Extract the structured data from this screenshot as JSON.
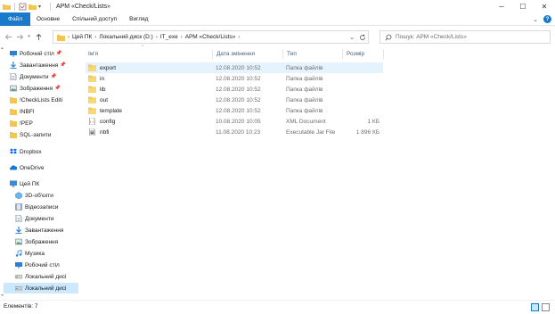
{
  "window": {
    "title": "АРМ «Check/Lists»",
    "controls": {
      "minimize": "─",
      "maximize": "☐",
      "close": "✕"
    }
  },
  "ribbon": {
    "tabs": [
      "Файл",
      "Основне",
      "Спільний доступ",
      "Вигляд"
    ],
    "expand_glyph": "⌄",
    "help_glyph": "?"
  },
  "address_bar": {
    "breadcrumbs": [
      "Цей ПК",
      "Локальний диск (D:)",
      "IT_exe",
      "АРМ «Check/Lists»"
    ],
    "separator": "›"
  },
  "search": {
    "placeholder": "Пошук: АРМ «Check/Lists»"
  },
  "nav_pane": {
    "items": [
      {
        "label": "Робочий стіл",
        "icon": "desktop-icon",
        "pinned": true
      },
      {
        "label": "Завантаження",
        "icon": "download-icon",
        "pinned": true
      },
      {
        "label": "Документи",
        "icon": "documents-icon",
        "pinned": true
      },
      {
        "label": "Зображення",
        "icon": "pictures-icon",
        "pinned": true
      },
      {
        "label": "!CheckLists Editi",
        "icon": "folder-icon",
        "pinned": false
      },
      {
        "label": "INBFI",
        "icon": "folder-icon",
        "pinned": false
      },
      {
        "label": "!PEP",
        "icon": "folder-icon",
        "pinned": false
      },
      {
        "label": "SQL-запити",
        "icon": "folder-icon",
        "pinned": false
      },
      {
        "label": "Dropbox",
        "icon": "dropbox-icon",
        "pinned": false
      },
      {
        "label": "OneDrive",
        "icon": "onedrive-icon",
        "pinned": false
      },
      {
        "label": "Цей ПК",
        "icon": "computer-icon",
        "pinned": false
      },
      {
        "label": "3D-об'єкти",
        "icon": "3d-objects-icon",
        "pinned": false
      },
      {
        "label": "Відеозаписи",
        "icon": "videos-icon",
        "pinned": false
      },
      {
        "label": "Документи",
        "icon": "documents-icon",
        "pinned": false
      },
      {
        "label": "Завантаження",
        "icon": "download-icon",
        "pinned": false
      },
      {
        "label": "Зображення",
        "icon": "pictures-icon",
        "pinned": false
      },
      {
        "label": "Музика",
        "icon": "music-icon",
        "pinned": false
      },
      {
        "label": "Робочий стіл",
        "icon": "desktop-icon",
        "pinned": false
      },
      {
        "label": "Локальний дисі",
        "icon": "drive-icon",
        "pinned": false
      },
      {
        "label": "Локальний дисі",
        "icon": "drive-icon",
        "pinned": false
      }
    ]
  },
  "columns": {
    "name": "Ім'я",
    "date": "Дата змінення",
    "type": "Тип",
    "size": "Розмір"
  },
  "files": [
    {
      "name": "export",
      "date": "12.08.2020 10:52",
      "type": "Папка файлів",
      "size": "",
      "icon": "folder-icon"
    },
    {
      "name": "in",
      "date": "12.08.2020 10:52",
      "type": "Папка файлів",
      "size": "",
      "icon": "folder-icon"
    },
    {
      "name": "lib",
      "date": "12.08.2020 10:52",
      "type": "Папка файлів",
      "size": "",
      "icon": "folder-icon"
    },
    {
      "name": "out",
      "date": "12.08.2020 10:52",
      "type": "Папка файлів",
      "size": "",
      "icon": "folder-icon"
    },
    {
      "name": "template",
      "date": "12.08.2020 10:52",
      "type": "Папка файлів",
      "size": "",
      "icon": "folder-icon"
    },
    {
      "name": "config",
      "date": "10.08.2020 10:05",
      "type": "XML Document",
      "size": "1 КБ",
      "icon": "xml-file-icon"
    },
    {
      "name": "nbfi",
      "date": "11.08.2020 10:23",
      "type": "Executable Jar File",
      "size": "1 896 КБ",
      "icon": "jar-file-icon"
    }
  ],
  "status": {
    "text": "Елементів: 7"
  },
  "colors": {
    "accent": "#1979ca",
    "folder": "#f3c74f",
    "selection": "#cce8ff",
    "hover": "#e5f3ff"
  }
}
